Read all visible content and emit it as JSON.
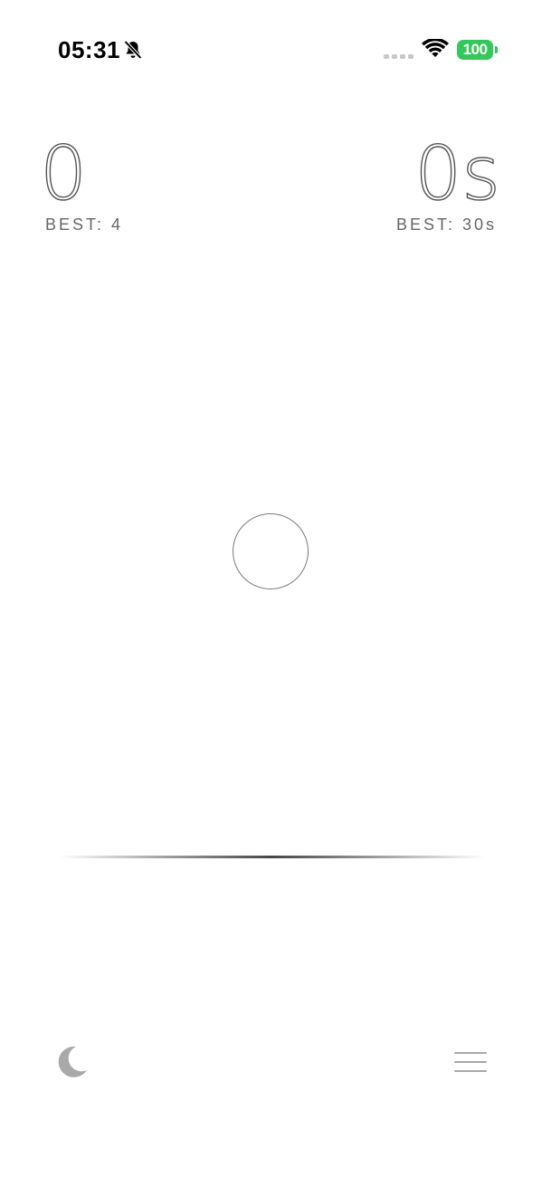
{
  "status_bar": {
    "time": "05:31",
    "battery_level": "100",
    "icons": [
      "bell-slash-icon",
      "cellular-signal-icon",
      "wifi-icon",
      "battery-icon"
    ],
    "battery_color": "#34c759"
  },
  "game": {
    "score": "0",
    "best_score": "BEST: 4",
    "time": "0s",
    "best_time": "BEST: 30s"
  },
  "controls": {
    "dark_mode_icon": "moon-icon",
    "menu_icon": "hamburger-menu-icon"
  }
}
